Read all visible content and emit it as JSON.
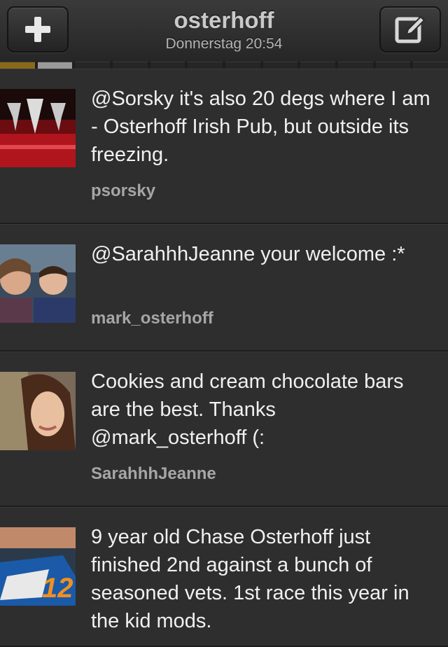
{
  "header": {
    "title": "osterhoff",
    "subtitle": "Donnerstag 20:54",
    "left_icon": "plus-icon",
    "right_icon": "compose-icon"
  },
  "tweets": [
    {
      "text": "@Sorsky it's also 20 degs where I am - Osterhoff Irish Pub, but outside its freezing.",
      "user": "psorsky",
      "avatar": "trophies-photo"
    },
    {
      "text": "@SarahhhJeanne your welcome :*",
      "user": "mark_osterhoff",
      "avatar": "selfie-photo"
    },
    {
      "text": "Cookies and cream chocolate bars are the best. Thanks @mark_osterhoff (:",
      "user": "SarahhhJeanne",
      "avatar": "girl-photo"
    },
    {
      "text": "9 year old Chase Osterhoff just finished 2nd against a bunch of seasoned vets. 1st race this year in the kid mods.",
      "user": "",
      "avatar": "race-car-photo"
    }
  ]
}
